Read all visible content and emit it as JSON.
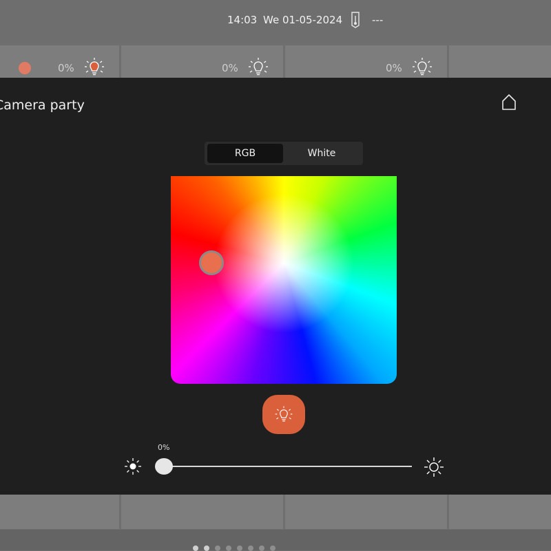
{
  "status_bar": {
    "time": "14:03",
    "date": "We 01-05-2024",
    "thermometer_icon": "thermometer-icon",
    "temperature": "---"
  },
  "tiles_top": [
    {
      "percent": "0%",
      "icon": "bulb-icon",
      "has_color_dot": true
    },
    {
      "percent": "0%",
      "icon": "bulb-icon",
      "has_color_dot": false
    },
    {
      "percent": "0%",
      "icon": "bulb-icon",
      "has_color_dot": false
    }
  ],
  "panel": {
    "title": "Camera party",
    "home_icon": "home-icon",
    "tabs": [
      {
        "label": "RGB",
        "active": true
      },
      {
        "label": "White",
        "active": false
      }
    ],
    "selected_color": "#e8704f",
    "toggle_icon": "bulb-icon",
    "brightness": {
      "value_label": "0%",
      "value": 0,
      "min_icon": "sun-dim-icon",
      "max_icon": "sun-bright-icon"
    }
  },
  "colors": {
    "accent": "#d9603a",
    "panel_bg": "#1f1f1f",
    "tile_bg": "#7d7d7d"
  }
}
